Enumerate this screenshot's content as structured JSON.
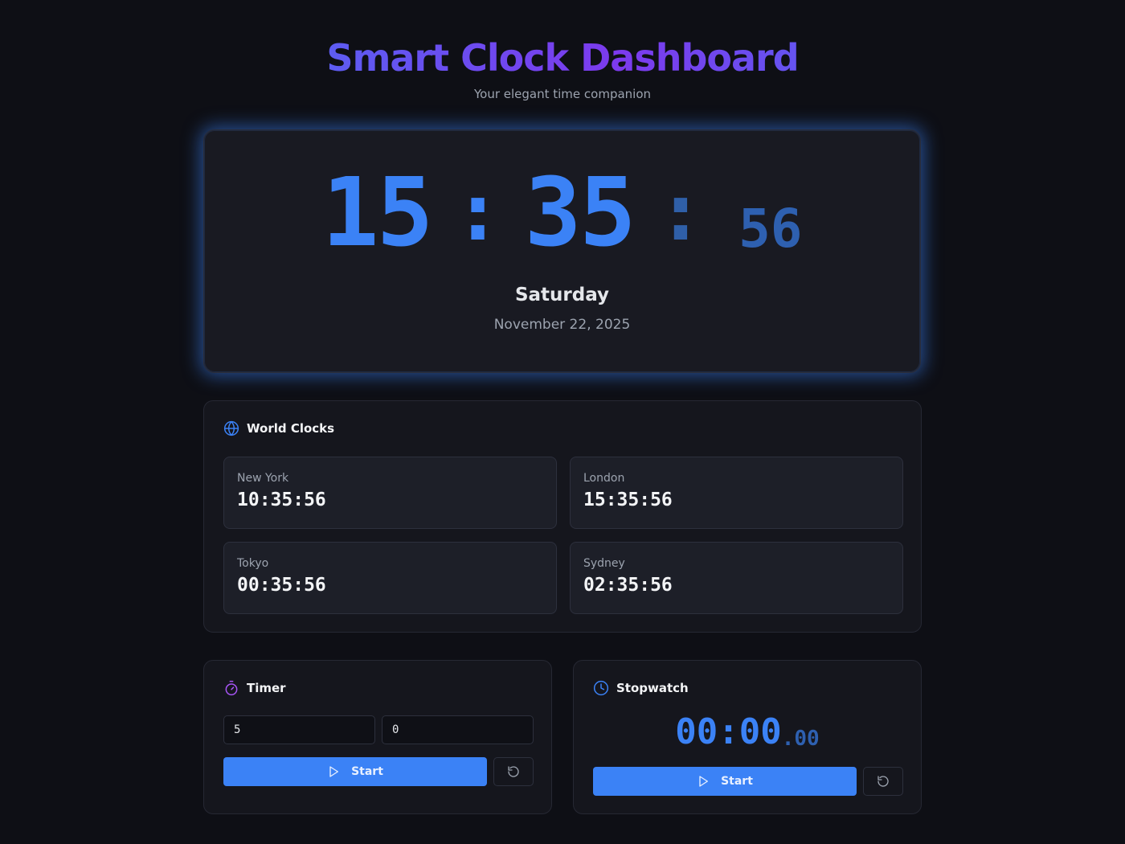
{
  "header": {
    "title": "Smart Clock Dashboard",
    "subtitle": "Your elegant time companion"
  },
  "main_clock": {
    "hours": "15",
    "minutes": "35",
    "seconds": "56",
    "separator": ":",
    "day": "Saturday",
    "date": "November 22, 2025"
  },
  "world_clocks": {
    "title": "World Clocks",
    "icon": "globe-icon",
    "cities": [
      {
        "name": "New York",
        "time": "10:35:56"
      },
      {
        "name": "London",
        "time": "15:35:56"
      },
      {
        "name": "Tokyo",
        "time": "00:35:56"
      },
      {
        "name": "Sydney",
        "time": "02:35:56"
      }
    ]
  },
  "timer": {
    "title": "Timer",
    "icon": "timer-icon",
    "minutes_value": "5",
    "seconds_value": "0",
    "start_label": "Start",
    "start_icon": "play-icon",
    "reset_icon": "reset-icon"
  },
  "stopwatch": {
    "title": "Stopwatch",
    "icon": "clock-icon",
    "display_main": "00:00",
    "display_ms": ".00",
    "start_label": "Start",
    "start_icon": "play-icon",
    "reset_icon": "reset-icon"
  },
  "colors": {
    "accent": "#3b82f6",
    "accent_purple": "#7c3aed",
    "background": "#0e0f15",
    "panel": "#15161d"
  }
}
